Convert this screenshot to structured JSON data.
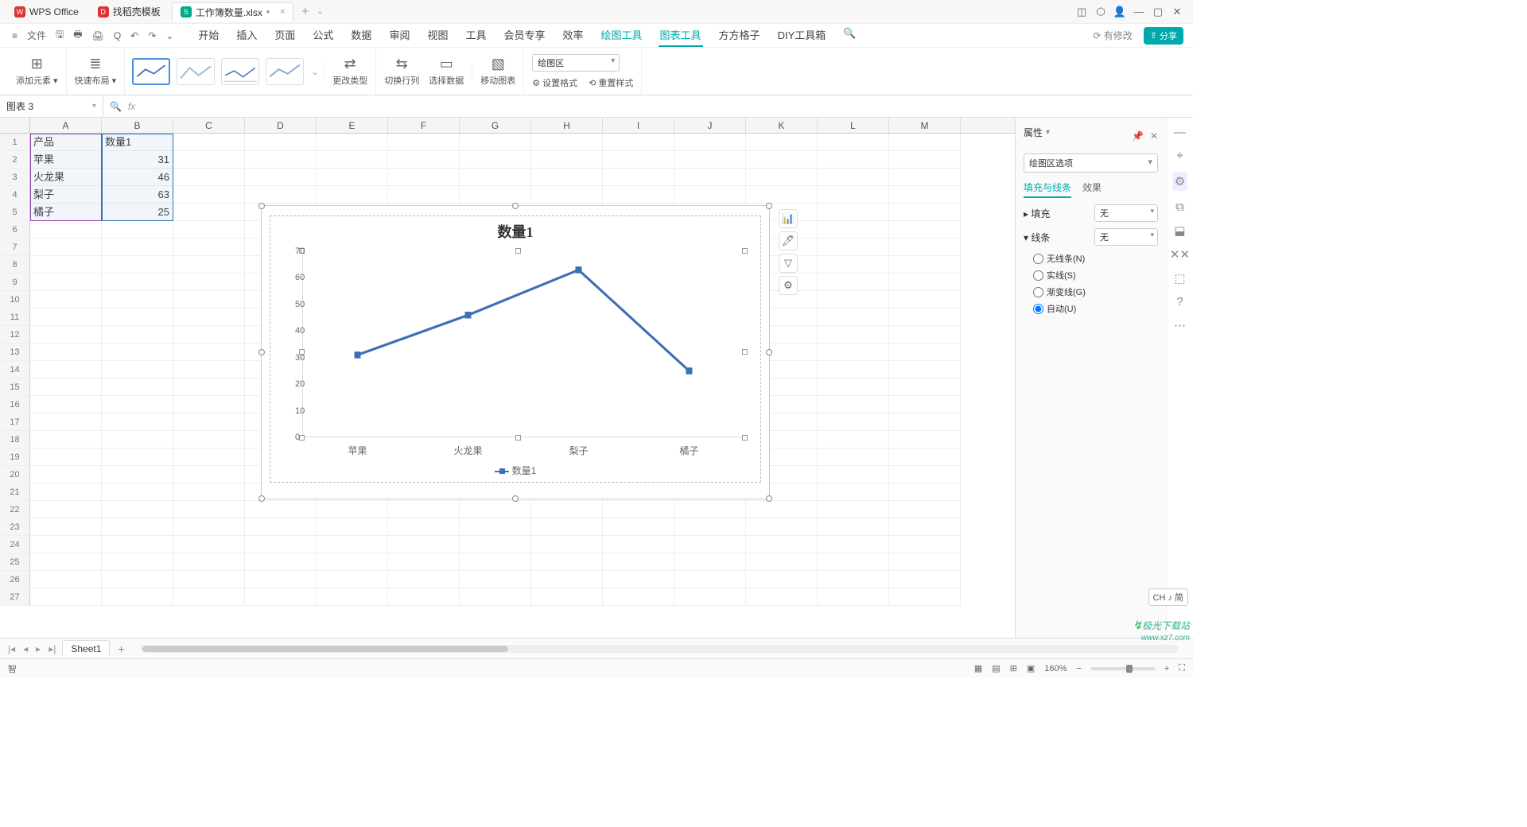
{
  "titlebar": {
    "tabs": [
      {
        "icon_bg": "#d33",
        "icon_txt": "W",
        "label": "WPS Office"
      },
      {
        "icon_bg": "#d33",
        "icon_txt": "D",
        "label": "找稻壳模板"
      },
      {
        "icon_bg": "#0a8",
        "icon_txt": "S",
        "label": "工作簿数量.xlsx",
        "active": true,
        "dirty": "•"
      }
    ],
    "add": "+",
    "drop": "⌄"
  },
  "menurow": {
    "hamburger": "≡",
    "file": "文件",
    "mini_icons": [
      "🖫",
      "🖶",
      "🖨",
      "Q",
      "↶",
      "↷",
      "⌄"
    ],
    "menus": [
      "开始",
      "插入",
      "页面",
      "公式",
      "数据",
      "审阅",
      "视图",
      "工具",
      "会员专享",
      "效率"
    ],
    "menus_hl": [
      "绘图工具"
    ],
    "menus_active": "图表工具",
    "menus_after": [
      "方方格子",
      "DIY工具箱"
    ],
    "search": "🔍",
    "cloud": "⟳ 有修改",
    "share": "分享"
  },
  "ribbon": {
    "add_elem": {
      "glyph": "⊞",
      "label": "添加元素 ▾"
    },
    "quick_layout": {
      "glyph": "≣",
      "label": "快速布局 ▾"
    },
    "change_type": {
      "glyph": "⇄",
      "label": "更改类型"
    },
    "swap_rc": {
      "glyph": "⇆",
      "label": "切换行列"
    },
    "select_data": {
      "glyph": "▭",
      "label": "选择数据"
    },
    "move_chart": {
      "glyph": "▧",
      "label": "移动图表"
    },
    "area_dd": "绘图区",
    "set_fmt": "⚙ 设置格式",
    "reset_style": "⟲ 重置样式"
  },
  "namebox": "图表 3",
  "fxsym": "fx",
  "columns": [
    "A",
    "B",
    "C",
    "D",
    "E",
    "F",
    "G",
    "H",
    "I",
    "J",
    "K",
    "L",
    "M"
  ],
  "table": {
    "headers": [
      "产品",
      "数量1"
    ],
    "rows": [
      [
        "苹果",
        "31"
      ],
      [
        "火龙果",
        "46"
      ],
      [
        "梨子",
        "63"
      ],
      [
        "橘子",
        "25"
      ]
    ]
  },
  "chart_data": {
    "type": "line",
    "title": "数量1",
    "categories": [
      "苹果",
      "火龙果",
      "梨子",
      "橘子"
    ],
    "series": [
      {
        "name": "数量1",
        "values": [
          31,
          46,
          63,
          25
        ]
      }
    ],
    "ylim": [
      0,
      70
    ],
    "ystep": 10,
    "xlabel": "",
    "ylabel": ""
  },
  "float_tools": [
    "📊",
    "🖊",
    "▽",
    "⚙"
  ],
  "propanel": {
    "title": "属性",
    "pin": "📌",
    "close": "✕",
    "area_dd": "绘图区选项",
    "tabs": [
      "填充与线条",
      "效果"
    ],
    "fill_label": "填充",
    "fill_val": "无",
    "line_label": "线条",
    "line_val": "无",
    "radios": [
      "无线条(N)",
      "实线(S)",
      "渐变线(G)",
      "自动(U)"
    ],
    "radio_sel": 3
  },
  "sidetools": [
    "▣",
    "⌖",
    "⬚",
    "⧉",
    "⬓",
    "✕✕",
    "⬚",
    "?",
    "⋯"
  ],
  "sheettabs": {
    "nav": [
      "|◂",
      "◂",
      "▸",
      "▸|"
    ],
    "sheet": "Sheet1",
    "add": "+"
  },
  "status": {
    "left": "智",
    "views": [
      "▦",
      "▤",
      "⊞",
      "▣"
    ],
    "zoom": "160%",
    "minus": "−",
    "plus": "+"
  },
  "ime": "CH ♪ 简",
  "watermark": {
    "a": "极光下载站",
    "b": "www.xz7.com"
  }
}
